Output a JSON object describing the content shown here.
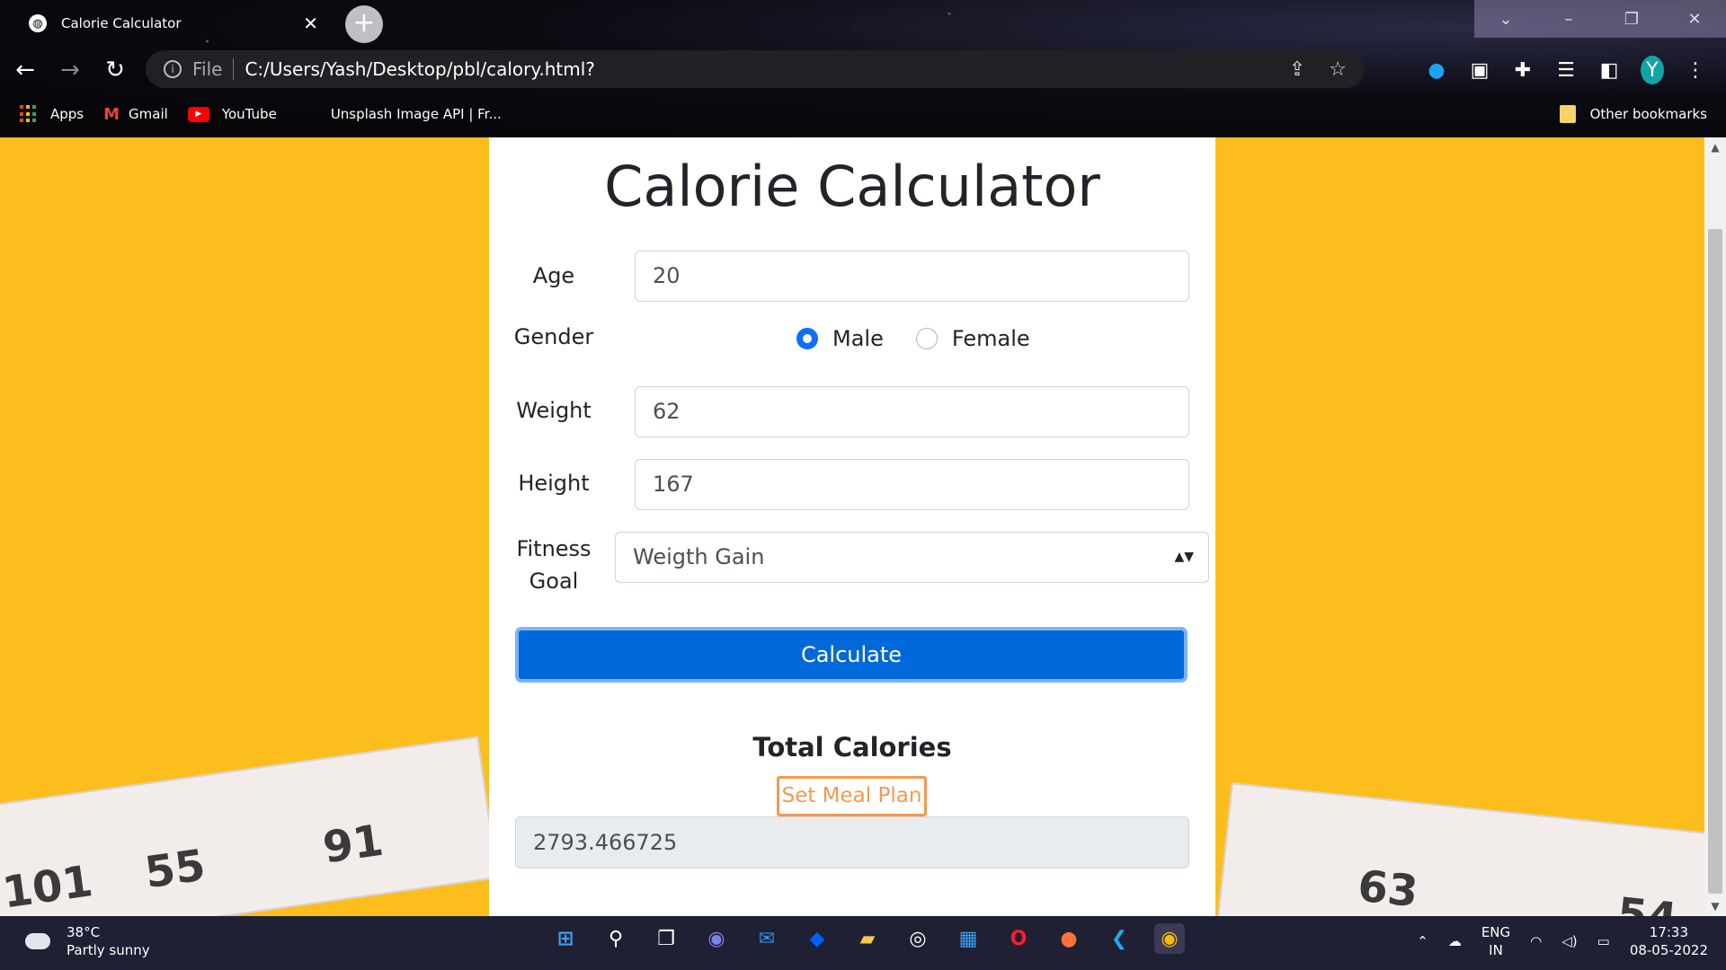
{
  "browser": {
    "tab_title": "Calorie Calculator",
    "url_prefix": "File",
    "url": "C:/Users/Yash/Desktop/pbl/calory.html?",
    "profile_initial": "Y",
    "bookmarks": [
      {
        "label": "Apps"
      },
      {
        "label": "Gmail"
      },
      {
        "label": "YouTube"
      },
      {
        "label": "Unsplash Image API | Fr..."
      }
    ],
    "other_bookmarks": "Other bookmarks"
  },
  "form": {
    "title": "Calorie Calculator",
    "age_label": "Age",
    "age_value": "20",
    "gender_label": "Gender",
    "gender_options": [
      "Male",
      "Female"
    ],
    "gender_selected": "Male",
    "weight_label": "Weight",
    "weight_value": "62",
    "height_label": "Height",
    "height_value": "167",
    "goal_label_line1": "Fitness",
    "goal_label_line2": "Goal",
    "goal_selected": "Weigth Gain",
    "calculate_label": "Calculate",
    "total_label": "Total Calories",
    "meal_plan_label": "Set Meal Plan",
    "result_value": "2793.466725"
  },
  "taskbar": {
    "temperature": "38°C",
    "weather_desc": "Partly sunny",
    "lang_line1": "ENG",
    "lang_line2": "IN",
    "time": "17:33",
    "date": "08-05-2022"
  },
  "colors": {
    "page_bg": "#fbbe1c",
    "primary": "#0069d9",
    "meal_plan": "#f39a4f"
  },
  "icons": [
    "globe-icon",
    "back-icon",
    "forward-icon",
    "reload-icon",
    "info-icon",
    "share-icon",
    "star-icon",
    "extension-icon",
    "avatar",
    "windows-start-icon",
    "search-icon",
    "chrome-icon"
  ]
}
